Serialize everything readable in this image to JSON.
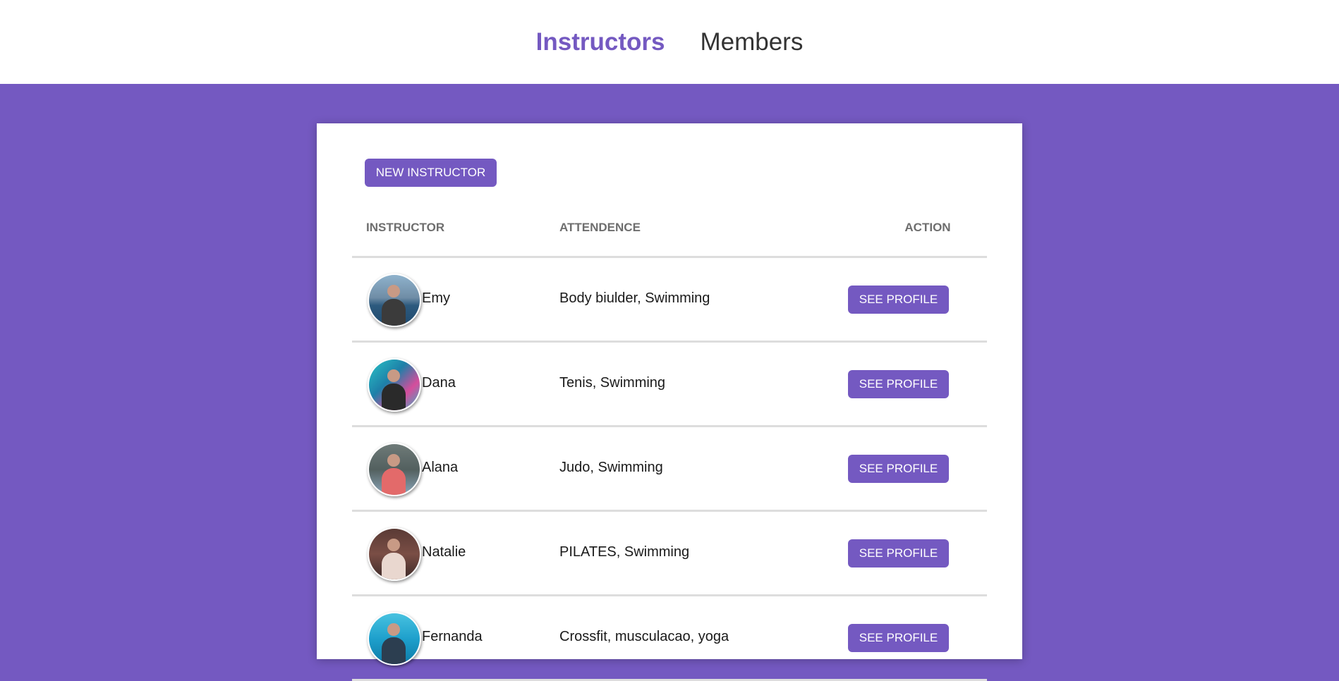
{
  "nav": {
    "instructors": "Instructors",
    "members": "Members"
  },
  "colors": {
    "accent": "#7459c1",
    "background": "#7459c1",
    "text": "#1a1a1a"
  },
  "new_instructor_label": "NEW INSTRUCTOR",
  "table": {
    "headers": {
      "instructor": "INSTRUCTOR",
      "attendence": "ATTENDENCE",
      "action": "ACTION"
    },
    "rows": [
      {
        "name": "Emy",
        "attendence": "Body biulder, Swimming",
        "action": "SEE PROFILE"
      },
      {
        "name": "Dana",
        "attendence": "Tenis, Swimming",
        "action": "SEE PROFILE"
      },
      {
        "name": "Alana",
        "attendence": "Judo, Swimming",
        "action": "SEE PROFILE"
      },
      {
        "name": "Natalie",
        "attendence": "PILATES, Swimming",
        "action": "SEE PROFILE"
      },
      {
        "name": "Fernanda",
        "attendence": "Crossfit, musculacao, yoga",
        "action": "SEE PROFILE"
      }
    ]
  }
}
